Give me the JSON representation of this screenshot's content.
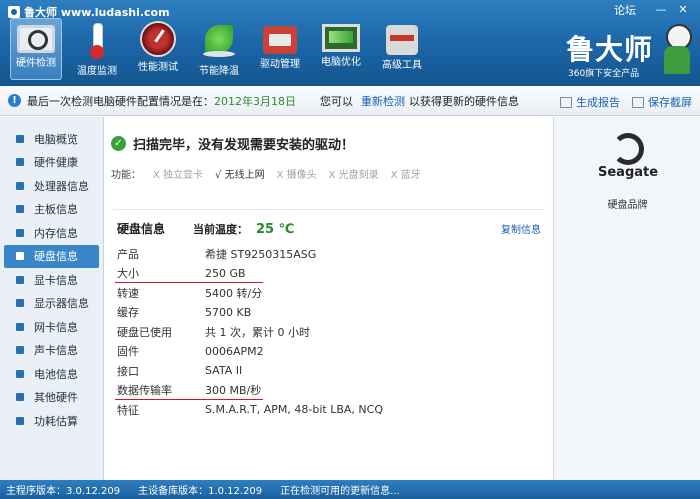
{
  "window": {
    "title": "鲁大师 www.ludashi.com",
    "forum": "论坛",
    "minimize": "—",
    "close": "✕"
  },
  "nav": [
    {
      "label": "硬件检测",
      "icon": "magnifier-monitor-icon"
    },
    {
      "label": "温度监测",
      "icon": "thermometer-icon"
    },
    {
      "label": "性能测试",
      "icon": "speed-gauge-icon"
    },
    {
      "label": "节能降温",
      "icon": "leaf-icon"
    },
    {
      "label": "驱动管理",
      "icon": "toolbox-icon"
    },
    {
      "label": "电脑优化",
      "icon": "screen-icon"
    },
    {
      "label": "高级工具",
      "icon": "wrench-icon"
    }
  ],
  "brand": {
    "name": "鲁大师",
    "tagline": "360旗下安全产品"
  },
  "infobar": {
    "prefix": "最后一次检测电脑硬件配置情况是在：",
    "date": "2012年3月18日",
    "you_can": "您可以",
    "redetect": "重新检测",
    "suffix": "以获得更新的硬件信息",
    "report": "生成报告",
    "screenshot": "保存截屏"
  },
  "sidebar": [
    {
      "label": "电脑概览"
    },
    {
      "label": "硬件健康"
    },
    {
      "label": "处理器信息"
    },
    {
      "label": "主板信息"
    },
    {
      "label": "内存信息"
    },
    {
      "label": "硬盘信息",
      "active": true
    },
    {
      "label": "显卡信息"
    },
    {
      "label": "显示器信息"
    },
    {
      "label": "网卡信息"
    },
    {
      "label": "声卡信息"
    },
    {
      "label": "电池信息"
    },
    {
      "label": "其他硬件"
    },
    {
      "label": "功耗估算"
    }
  ],
  "main": {
    "scan_status": "扫描完毕，没有发现需要安装的驱动！",
    "features_label": "功能：",
    "features": [
      {
        "text": "X 独立显卡",
        "on": false
      },
      {
        "text": "√ 无线上网",
        "on": true
      },
      {
        "text": "X 摄像头",
        "on": false
      },
      {
        "text": "X 光盘刻录",
        "on": false
      },
      {
        "text": "X 蓝牙",
        "on": false
      }
    ],
    "disk_title": "硬盘信息",
    "temp_label": "当前温度：",
    "temp_value": "25 ℃",
    "copy_info": "复制信息",
    "specs": [
      {
        "key": "产品",
        "value": "希捷 ST9250315ASG"
      },
      {
        "key": "大小",
        "value": "250 GB",
        "underline": true
      },
      {
        "key": "转速",
        "value": "5400 转/分"
      },
      {
        "key": "缓存",
        "value": "5700 KB"
      },
      {
        "key": "硬盘已使用",
        "value": "共 1 次，累计 0 小时"
      },
      {
        "key": "固件",
        "value": "0006APM2"
      },
      {
        "key": "接口",
        "value": "SATA II"
      },
      {
        "key": "数据传输率",
        "value": "300 MB/秒",
        "underline": true
      },
      {
        "key": "特征",
        "value": "S.M.A.R.T,  APM,  48-bit LBA,  NCQ"
      }
    ]
  },
  "right_panel": {
    "logo_text": "Seagate",
    "caption": "硬盘品牌"
  },
  "statusbar": {
    "program_version": "主程序版本：3.0.12.209",
    "device_db_version": "主设备库版本：1.0.12.209",
    "status": "正在检测可用的更新信息..."
  }
}
